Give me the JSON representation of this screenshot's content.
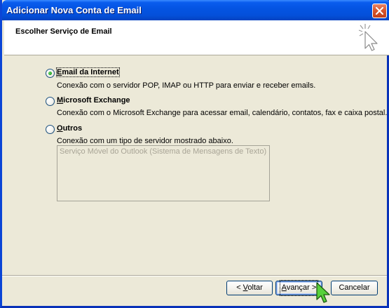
{
  "window": {
    "title": "Adicionar Nova Conta de Email"
  },
  "header": {
    "title": "Escolher Serviço de Email"
  },
  "options": [
    {
      "label_ul": "E",
      "label_rest": "mail da Internet",
      "description": "Conexão com o servidor POP, IMAP ou HTTP para enviar e receber emails.",
      "selected": true
    },
    {
      "label_ul": "M",
      "label_rest": "icrosoft Exchange",
      "description": "Conexão com o Microsoft Exchange para acessar email, calendário, contatos, fax e caixa postal.",
      "selected": false
    },
    {
      "label_ul": "O",
      "label_rest": "utros",
      "description": "Conexão com um tipo de servidor mostrado abaixo.",
      "selected": false
    }
  ],
  "other_servers": [
    "Serviço Móvel do Outlook (Sistema de Mensagens de Texto)"
  ],
  "buttons": {
    "back_prefix": "< ",
    "back_ul": "V",
    "back_rest": "oltar",
    "next_ul": "A",
    "next_rest": "vançar >",
    "cancel": "Cancelar"
  },
  "colors": {
    "titlebar": "#0454E3",
    "dialog": "#ECE9D8",
    "selected_radio": "#21A121"
  },
  "icons": [
    "close-icon",
    "wizard-cursor-icon",
    "mouse-pointer-icon"
  ]
}
